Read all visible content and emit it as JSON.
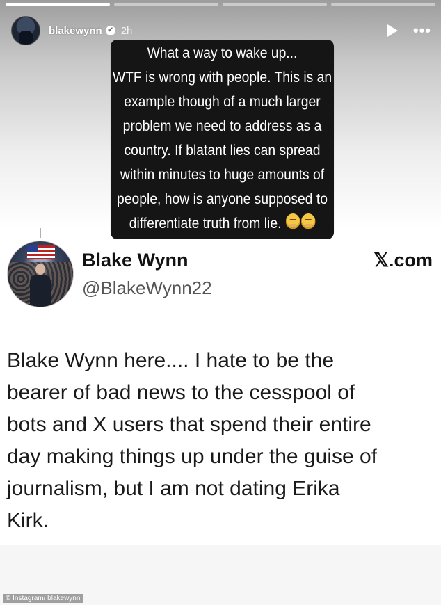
{
  "story": {
    "segments": [
      true,
      false,
      false,
      false
    ]
  },
  "header": {
    "username": "blakewynn",
    "verified_glyph": "✔",
    "time": "2h"
  },
  "caption": {
    "lines": [
      "What a way to wake up...",
      "WTF is wrong with people. This is an",
      "example though of a much larger",
      "problem we need to address as a",
      "country. If blatant lies can spread",
      "within minutes to huge amounts of",
      "people, how is anyone supposed to",
      "differentiate truth from lie."
    ],
    "emoji": [
      "facepalm-emoji",
      "facepalm-emoji"
    ]
  },
  "post": {
    "display_name": "Blake Wynn",
    "handle": "@BlakeWynn22",
    "source": "𝕏.com",
    "text_lines": [
      "Blake Wynn here.... I hate to be the",
      "bearer of bad news to the cesspool of",
      "bots and X users that spend their entire",
      "day making things up under the guise of",
      "journalism, but I am not dating Erika",
      "Kirk."
    ]
  },
  "credit": "© Instagram/ blakewynn",
  "colors": {
    "caption_bg": "#151515",
    "text": "#111111",
    "handle": "#555555"
  }
}
